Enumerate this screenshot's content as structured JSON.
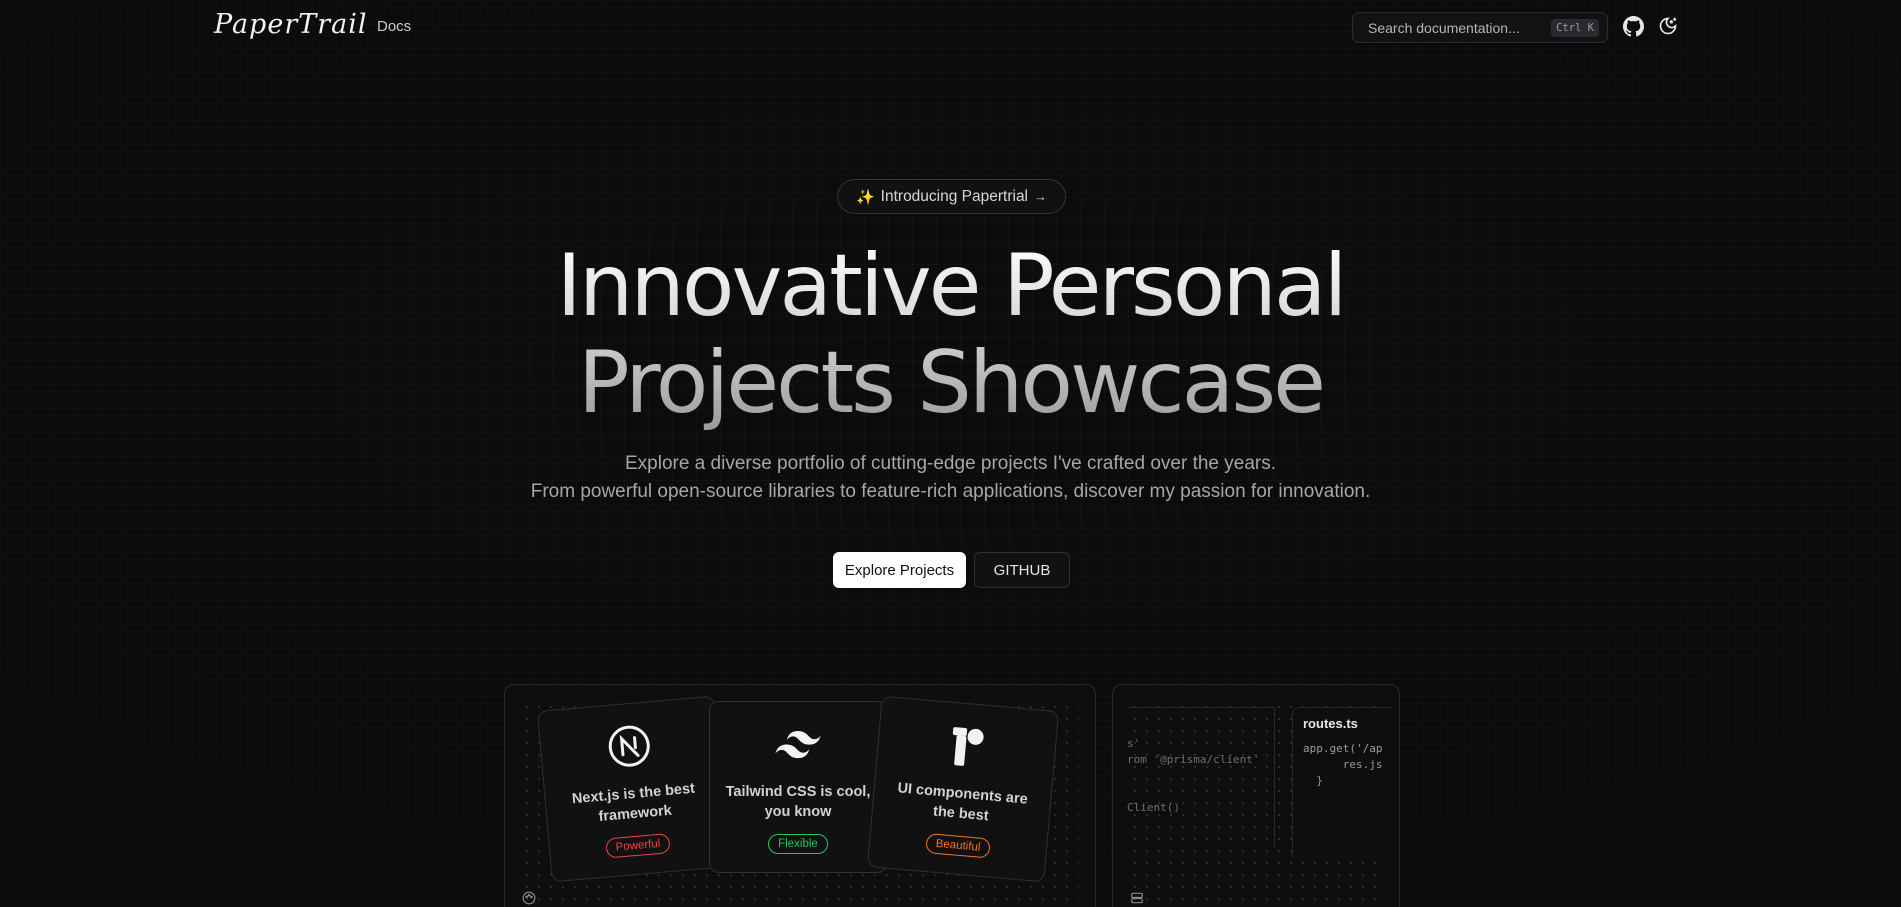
{
  "header": {
    "logo": "PaperTrail",
    "nav_docs": "Docs",
    "search_placeholder": "Search documentation...",
    "search_shortcut": "Ctrl K"
  },
  "hero": {
    "badge_icon": "✨",
    "badge_text": "Introducing Papertrial",
    "badge_arrow": "→",
    "title_line1": "Innovative Personal",
    "title_line2": "Projects Showcase",
    "subtitle_line1": "Explore a diverse portfolio of cutting-edge projects I've crafted over the years.",
    "subtitle_line2": "From powerful open-source libraries to feature-rich applications, discover my passion for innovation.",
    "primary_cta": "Explore Projects",
    "secondary_cta": "GITHUB"
  },
  "feature_cards": [
    {
      "icon": "nextjs-icon",
      "text": "Next.js is the best framework",
      "tag": "Powerful",
      "tag_color": "#ef4444"
    },
    {
      "icon": "tailwind-icon",
      "text": "Tailwind CSS is cool, you know",
      "tag": "Flexible",
      "tag_color": "#22c55e"
    },
    {
      "icon": "ui-components-icon",
      "text": "UI components are the best",
      "tag": "Beautiful",
      "tag_color": "#f97316"
    }
  ],
  "code_panel": {
    "lines": [
      "s'",
      "rom '@prisma/client'",
      "Client()"
    ],
    "file_name": "routes.ts",
    "file_code": "app.get('/ap\n      res.js\n  }"
  }
}
